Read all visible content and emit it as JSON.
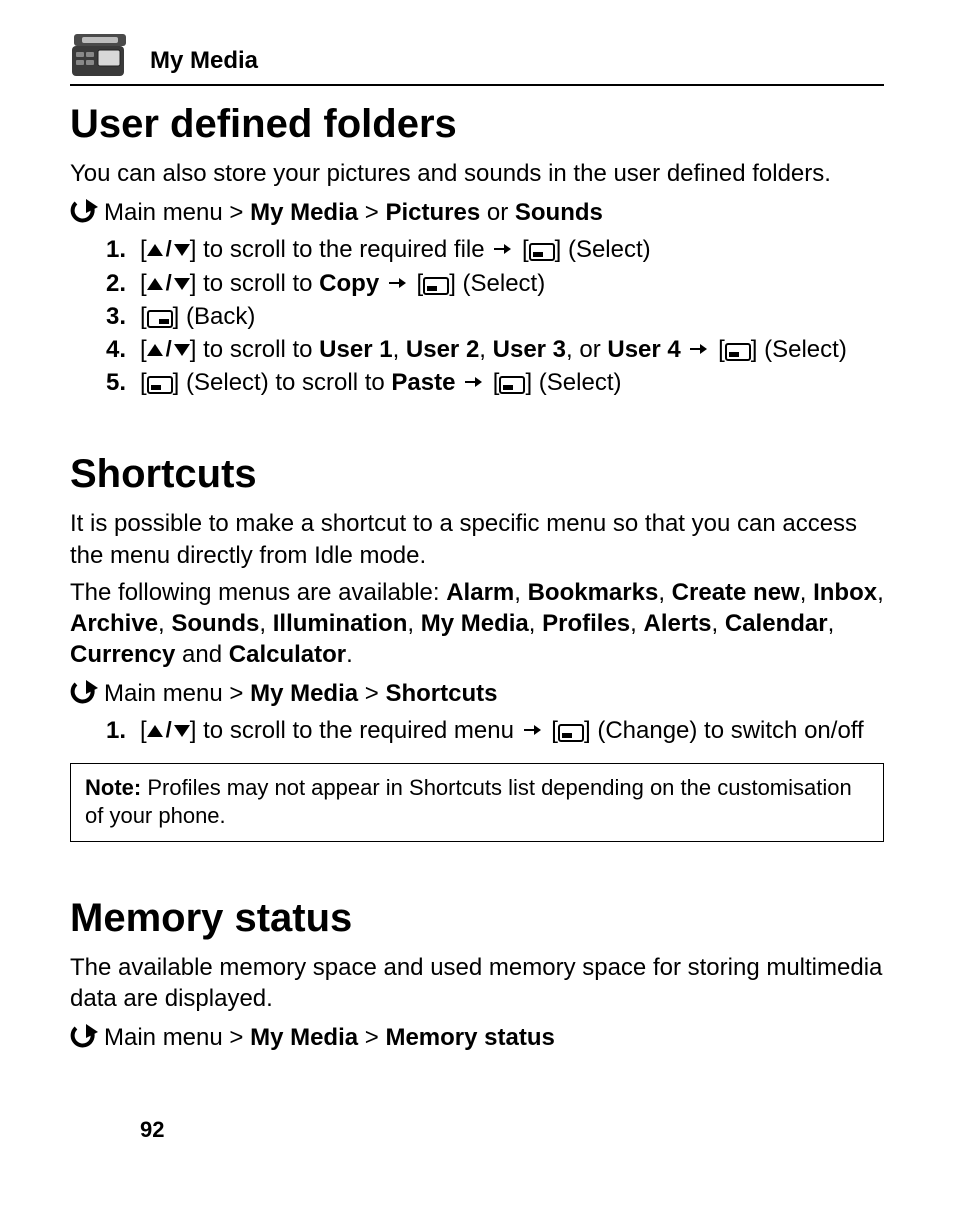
{
  "header": {
    "section": "My Media"
  },
  "page_number": "92",
  "s1": {
    "title": "User defined folders",
    "intro": "You can also store your pictures and sounds in the user defined folders.",
    "nav_prefix": "Main menu > ",
    "nav_b1": "My Media",
    "nav_mid": " > ",
    "nav_b2": "Pictures",
    "nav_or": " or ",
    "nav_b3": "Sounds",
    "steps": {
      "n1": "1.",
      "n2": "2.",
      "n3": "3.",
      "n4": "4.",
      "n5": "5.",
      "t1a": "] to scroll to the required file ",
      "t1b": "] (Select)",
      "t2a": "] to scroll to ",
      "t2b": "Copy",
      "t2c": "] (Select)",
      "t3a": "] (Back)",
      "t4a": "] to scroll to ",
      "t4b": "User 1",
      "t4c": ", ",
      "t4d": "User 2",
      "t4e": ", ",
      "t4f": "User 3",
      "t4g": ", or ",
      "t4h": "User 4",
      "t4i": "] (Select)",
      "t5a": "] (Select) to scroll to ",
      "t5b": "Paste",
      "t5c": "] (Select)"
    }
  },
  "s2": {
    "title": "Shortcuts",
    "intro": "It is possible to make a shortcut to a specific menu so that you can access the menu directly from Idle mode.",
    "menus_prefix": "The following menus are available: ",
    "m1": "Alarm",
    "c1": ", ",
    "m2": "Bookmarks",
    "c2": ", ",
    "m3": "Create new",
    "c3": ", ",
    "m4": "Inbox",
    "c4": ", ",
    "m5": "Archive",
    "c5": ", ",
    "m6": "Sounds",
    "c6": ", ",
    "m7": "Illumination",
    "c7": ", ",
    "m8": "My Media",
    "c8": ", ",
    "m9": "Profiles",
    "c9": ", ",
    "m10": "Alerts",
    "c10": ", ",
    "m11": "Calendar",
    "c11": ", ",
    "m12": "Currency",
    "and": " and ",
    "m13": "Calculator",
    "period": ".",
    "nav_prefix": "Main menu > ",
    "nav_b1": "My Media",
    "nav_mid": " > ",
    "nav_b2": "Shortcuts",
    "steps": {
      "n1": "1.",
      "t1a": "] to scroll to the required menu ",
      "t1b": "] (Change) to switch on/off"
    },
    "note_label": "Note:",
    "note_body": " Profiles may not appear in Shortcuts list depending on the customisation of your phone."
  },
  "s3": {
    "title": "Memory status",
    "intro": "The available memory space and used memory space for storing multimedia data are displayed.",
    "nav_prefix": "Main menu > ",
    "nav_b1": "My Media",
    "nav_mid": " > ",
    "nav_b2": "Memory status"
  }
}
